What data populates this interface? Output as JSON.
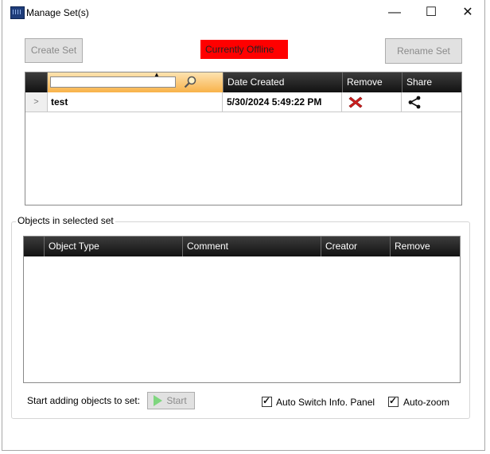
{
  "window": {
    "title": "Manage Set(s)",
    "minimize": "—",
    "maximize": "☐",
    "close": "✕"
  },
  "toolbar": {
    "create_label": "Create Set",
    "rename_label": "Rename Set",
    "status_text": "Currently Offline"
  },
  "sets_grid": {
    "search_value": "",
    "columns": [
      "Date Created",
      "Remove",
      "Share"
    ],
    "rows": [
      {
        "name": "test",
        "date": "5/30/2024 5:49:22 PM"
      }
    ]
  },
  "objects_group": {
    "label": "Objects in selected set",
    "columns": [
      "Object Type",
      "Comment",
      "Creator",
      "Remove"
    ]
  },
  "footer": {
    "start_prompt": "Start adding objects to set:",
    "start_label": "Start",
    "auto_switch_label": "Auto Switch Info. Panel",
    "auto_zoom_label": "Auto-zoom"
  }
}
